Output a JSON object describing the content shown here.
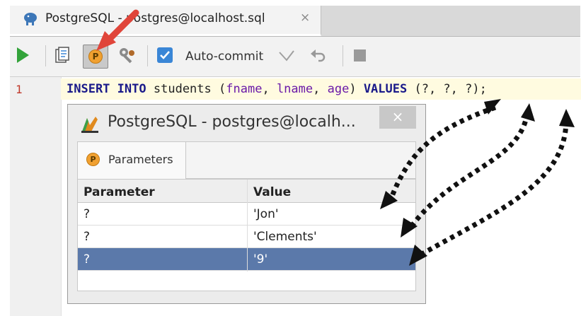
{
  "tab": {
    "title": "PostgreSQL - postgres@localhost.sql",
    "close": "×"
  },
  "toolbar": {
    "autocommit_label": "Auto-commit"
  },
  "editor": {
    "line_number": "1",
    "tokens": [
      "INSERT",
      "INTO",
      "students",
      "(",
      "fname",
      "lname",
      "age",
      "VALUES",
      "(?, ?, ?);"
    ]
  },
  "dialog": {
    "title": "PostgreSQL - postgres@localh...",
    "close": "×",
    "tab_label": "Parameters",
    "tab_icon_letter": "P",
    "table": {
      "headers": [
        "Parameter",
        "Value"
      ],
      "rows": [
        {
          "param": "?",
          "value": "'Jon'"
        },
        {
          "param": "?",
          "value": "'Clements'"
        },
        {
          "param": "?",
          "value": "'9'"
        }
      ],
      "selected_row": 2
    }
  },
  "toolbar_params_letter": "P",
  "colors": {
    "selection": "#5b79aa",
    "accent": "#3a86d6",
    "run": "#33a33a",
    "pointer": "#e0453a"
  }
}
